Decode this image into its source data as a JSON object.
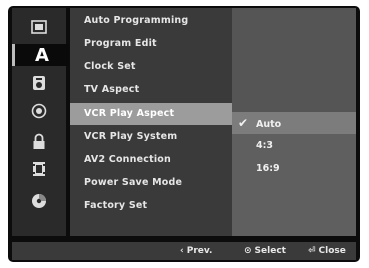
{
  "icons": [
    {
      "name": "disc-tray-icon",
      "glyph": "▤"
    },
    {
      "name": "language-a-icon",
      "glyph": "A"
    },
    {
      "name": "audio-settings-icon",
      "glyph": "▣"
    },
    {
      "name": "recording-icon",
      "glyph": "◉"
    },
    {
      "name": "lock-icon",
      "glyph": "🔒"
    },
    {
      "name": "film-icon",
      "glyph": "▦"
    },
    {
      "name": "disc-icon",
      "glyph": "●"
    }
  ],
  "menu": {
    "items": [
      {
        "label": "Auto Programming"
      },
      {
        "label": "Program Edit"
      },
      {
        "label": "Clock Set"
      },
      {
        "label": "TV Aspect"
      },
      {
        "label": "VCR Play Aspect"
      },
      {
        "label": "VCR Play System"
      },
      {
        "label": "AV2 Connection"
      },
      {
        "label": "Power Save Mode"
      },
      {
        "label": "Factory Set"
      }
    ],
    "selected_index": 4
  },
  "submenu": {
    "options": [
      {
        "label": "Auto",
        "checked": "✔"
      },
      {
        "label": "4:3",
        "checked": ""
      },
      {
        "label": "16:9",
        "checked": ""
      }
    ]
  },
  "footer": {
    "prev_symbol": "‹",
    "prev_label": "Prev.",
    "select_symbol": "⊙",
    "select_label": "Select",
    "close_symbol": "⏎",
    "close_label": "Close"
  }
}
